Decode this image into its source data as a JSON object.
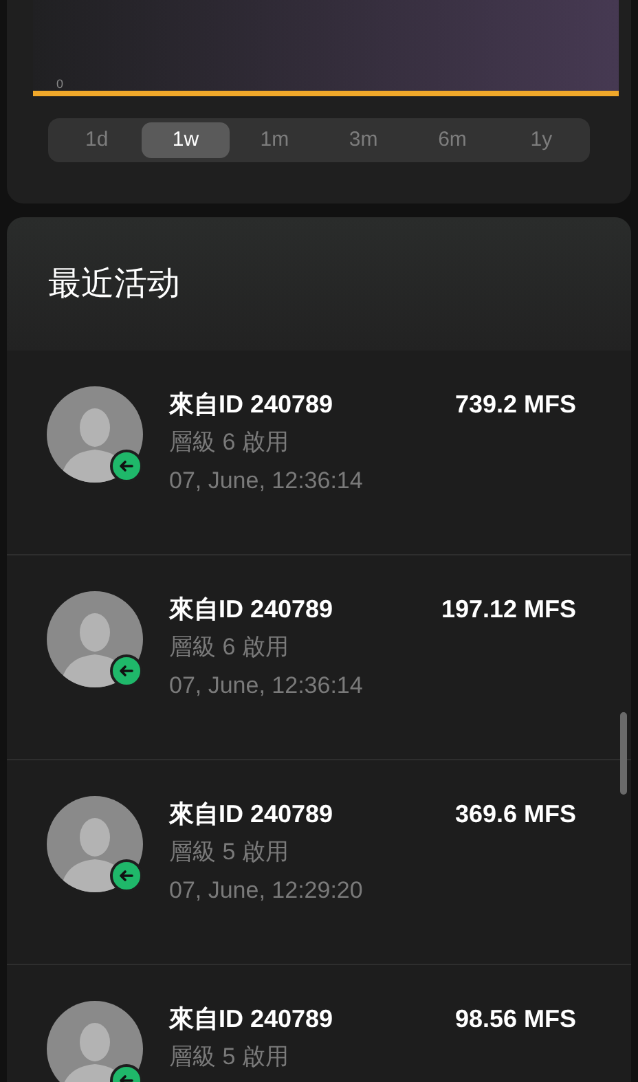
{
  "chart": {
    "axis_label": "0"
  },
  "ranges": [
    {
      "label": "1d",
      "selected": false
    },
    {
      "label": "1w",
      "selected": true
    },
    {
      "label": "1m",
      "selected": false
    },
    {
      "label": "3m",
      "selected": false
    },
    {
      "label": "6m",
      "selected": false
    },
    {
      "label": "1y",
      "selected": false
    }
  ],
  "activity": {
    "title": "最近活动",
    "items": [
      {
        "title": "來自ID 240789",
        "amount": "739.2 MFS",
        "level_text": "層級 6 啟用",
        "time": "07, June, 12:36:14"
      },
      {
        "title": "來自ID 240789",
        "amount": "197.12 MFS",
        "level_text": "層級 6 啟用",
        "time": "07, June, 12:36:14"
      },
      {
        "title": "來自ID 240789",
        "amount": "369.6 MFS",
        "level_text": "層級 5 啟用",
        "time": "07, June, 12:29:20"
      },
      {
        "title": "來自ID 240789",
        "amount": "98.56 MFS",
        "level_text": "層級 5 啟用"
      }
    ]
  }
}
